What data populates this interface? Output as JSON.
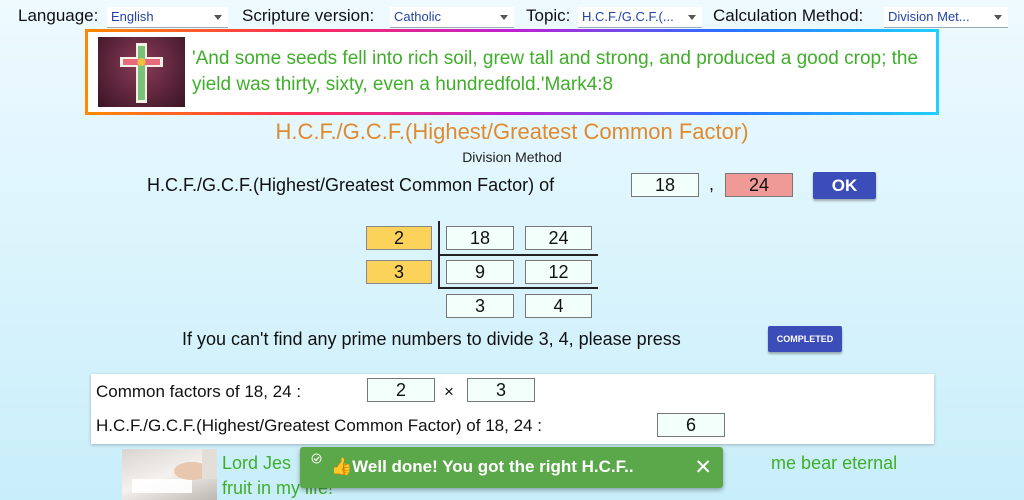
{
  "topbar": {
    "language_label": "Language:",
    "language_value": "English",
    "scripture_label": "Scripture version:",
    "scripture_value": "Catholic",
    "topic_label": "Topic:",
    "topic_value": "H.C.F./G.C.F.(...",
    "method_label": "Calculation Method:",
    "method_value": "Division Met..."
  },
  "verse": {
    "text": "'And some seeds fell into rich soil, grew tall and strong, and produced a good crop; the yield was thirty, sixty, even a hundredfold.'Mark4:8",
    "image_icon": "cross-icon"
  },
  "main": {
    "title": "H.C.F./G.C.F.(Highest/Greatest Common Factor)",
    "subtitle": "Division Method",
    "prompt": "H.C.F./G.C.F.(Highest/Greatest Common Factor) of",
    "input_a": "18",
    "separator": ",",
    "input_b": "24",
    "ok_label": "OK"
  },
  "division": {
    "divisors": [
      "2",
      "3"
    ],
    "rows": [
      [
        "18",
        "24"
      ],
      [
        "9",
        "12"
      ],
      [
        "3",
        "4"
      ]
    ]
  },
  "instruction": {
    "text": "If you can't find any prime numbers to divide 3, 4, please press",
    "button_label": "COMPLETED"
  },
  "result": {
    "common_factors_label": "Common factors of  18, 24 :",
    "factor_1": "2",
    "times": "×",
    "factor_2": "3",
    "hcf_label": "H.C.F./G.C.F.(Highest/Greatest Common Factor) of  18, 24 :",
    "hcf_value": "6"
  },
  "footer_verse": {
    "text_line1_start": "Lord Jes",
    "text_line1_end": "me bear eternal",
    "text_line2": "fruit in my life!"
  },
  "toast": {
    "icon": "thumbs-up-icon",
    "emoji": "👍",
    "message": "Well done! You got the right H.C.F..",
    "close": "✕"
  },
  "colors": {
    "accent_blue": "#3b4db8",
    "verse_green": "#3fae2a",
    "title_orange": "#e08a2e",
    "toast_green": "#5aa84a",
    "divisor_yellow": "#fbd35a",
    "input_pink": "#ef9a96"
  }
}
